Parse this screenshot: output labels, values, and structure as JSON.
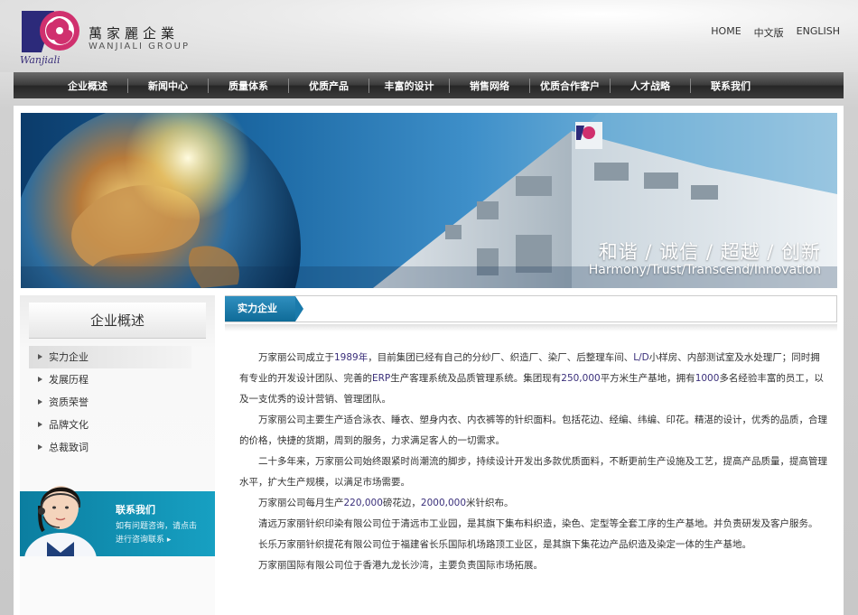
{
  "header": {
    "logo_cn": "萬家麗企業",
    "logo_en": "WANJIALI GROUP",
    "logo_script": "Wanjiali",
    "top_links": [
      "HOME",
      "中文版",
      "ENGLISH"
    ]
  },
  "nav": {
    "items": [
      "企业概述",
      "新闻中心",
      "质量体系",
      "优质产品",
      "丰富的设计",
      "销售网络",
      "优质合作客户",
      "人才战略",
      "联系我们"
    ]
  },
  "banner": {
    "slogan_cn": "和谐 / 诚信 / 超越 / 创新",
    "slogan_en": "Harmony/Trust/Transcend/Innovation"
  },
  "sidebar": {
    "title": "企业概述",
    "items": [
      "实力企业",
      "发展历程",
      "资质荣誉",
      "品牌文化",
      "总裁致词"
    ],
    "active_index": 0,
    "contact": {
      "title": "联系我们",
      "line1": "如有问题咨询，请点击",
      "line2": "进行咨询联系 ▸"
    }
  },
  "main": {
    "tab_label": "实力企业",
    "paragraphs": [
      [
        "万家丽公司成立于",
        "1989年",
        "，目前集团已经有自己的分纱厂、织造厂、染厂、后整理车间、",
        "L/D",
        "小样房、内部测试室及水处理厂；同时拥有专业的开发设计团队、完善的",
        "ERP",
        "生产客理系统及品质管理系统。集团现有",
        "250,000",
        "平方米生产基地，拥有",
        "1000",
        "多名经验丰富的员工，以及一支优秀的设计营销、管理团队。"
      ],
      [
        "万家丽公司主要生产适合泳衣、睡衣、塑身内衣、内衣裤等的针织面料。包括花边、经编、纬编、印花。精湛的设计，优秀的品质，合理的价格，快捷的货期，周到的服务，力求满足客人的一切需求。"
      ],
      [
        "二十多年来，万家丽公司始终跟紧时尚潮流的脚步，持续设计开发出多款优质面料，不断更前生产设施及工艺，提高产品质量，提高管理水平，扩大生产规模，以满足市场需要。"
      ],
      [
        "万家丽公司每月生产",
        "220,000",
        "磅花边，",
        "2000,000",
        "米针织布。"
      ],
      [
        "清远万家丽针织印染有限公司位于清远市工业园，是其旗下集布料织造，染色、定型等全套工序的生产基地。并负责研发及客户服务。"
      ],
      [
        "长乐万家丽针织提花有限公司位于福建省长乐国际机场路顶工业区，是其旗下集花边产品织造及染定一体的生产基地。"
      ],
      [
        "万家丽国际有限公司位于香港九龙长沙湾，主要负责国际市场拓展。"
      ]
    ]
  },
  "colors": {
    "brand_purple": "#3a2f7a",
    "brand_pink": "#d0306e",
    "accent_blue": "#1a7aab",
    "nav_dark": "#2e2e2e"
  }
}
